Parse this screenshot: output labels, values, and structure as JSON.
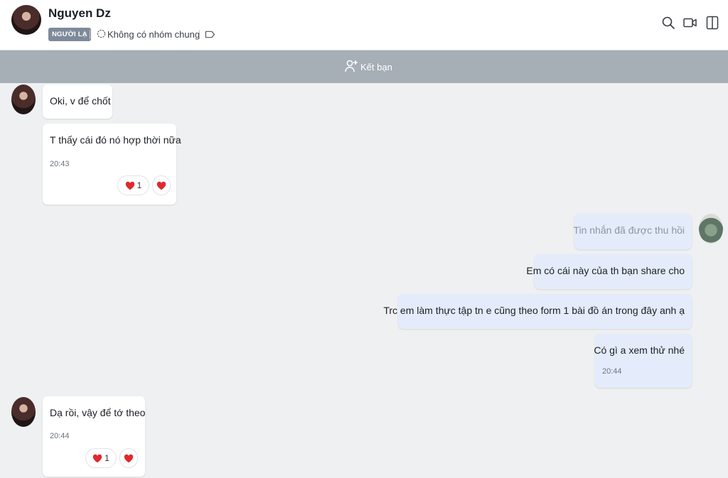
{
  "header": {
    "name": "Nguyen Dz",
    "badge": "NGƯỜI LẠ",
    "groups": "Không có nhóm chung"
  },
  "friend_bar": {
    "label": "Kết bạn"
  },
  "messages": [
    {
      "text": "Oki, v để chốt"
    },
    {
      "text": "T thấy cái đó nó hợp thời nữa",
      "time": "20:43",
      "reaction_count": "1"
    },
    {
      "text": "Tin nhắn đã được thu hồi"
    },
    {
      "text": "Em có cái này của th bạn share cho"
    },
    {
      "text": "Trc em làm thực tập tn e cũng theo form 1 bài đồ án trong đây anh ạ"
    },
    {
      "text": "Có gì a xem thử nhé",
      "time": "20:44"
    },
    {
      "text": "Dạ rồi, vậy để tớ theo",
      "time": "20:44",
      "reaction_count": "1"
    }
  ],
  "colors": {
    "accent_badge": "#7e8a99",
    "friend_bar": "#a6aeb6",
    "my_bubble": "#e4ecfb",
    "heart": "#e0282f"
  }
}
